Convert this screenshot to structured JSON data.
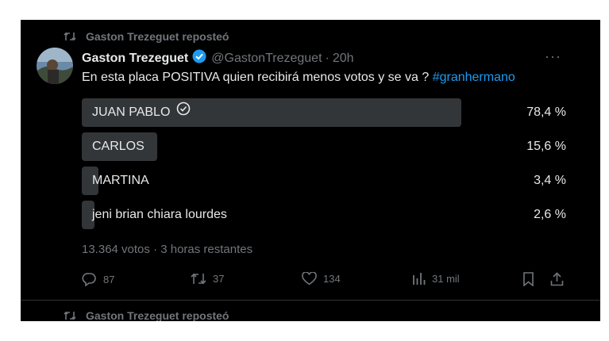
{
  "repost": {
    "label": "Gaston Trezeguet reposteó"
  },
  "tweet": {
    "author_name": "Gaston Trezeguet",
    "handle": "@GastonTrezeguet",
    "separator": "·",
    "time": "20h",
    "more": "···",
    "text": "En esta placa POSITIVA quien recibirá menos votos y se va ? ",
    "hashtag": "#granhermano"
  },
  "poll": {
    "options": [
      {
        "label": "JUAN PABLO",
        "percent_text": "78,4 %",
        "percent": 78.4,
        "selected": true
      },
      {
        "label": "CARLOS",
        "percent_text": "15,6 %",
        "percent": 15.6,
        "selected": false
      },
      {
        "label": "MARTINA",
        "percent_text": "3,4 %",
        "percent": 3.4,
        "selected": false
      },
      {
        "label": "jeni brian chiara lourdes",
        "percent_text": "2,6 %",
        "percent": 2.6,
        "selected": false
      }
    ],
    "meta": "13.364 votos · 3 horas restantes"
  },
  "actions": {
    "replies": "87",
    "reposts": "37",
    "likes": "134",
    "views": "31 mil"
  },
  "next_repost": {
    "label": "Gaston Trezeguet reposteó"
  },
  "colors": {
    "background": "#000000",
    "text": "#e7e9ea",
    "muted": "#71767b",
    "poll_bar": "#333639",
    "accent": "#1d9bf0"
  }
}
